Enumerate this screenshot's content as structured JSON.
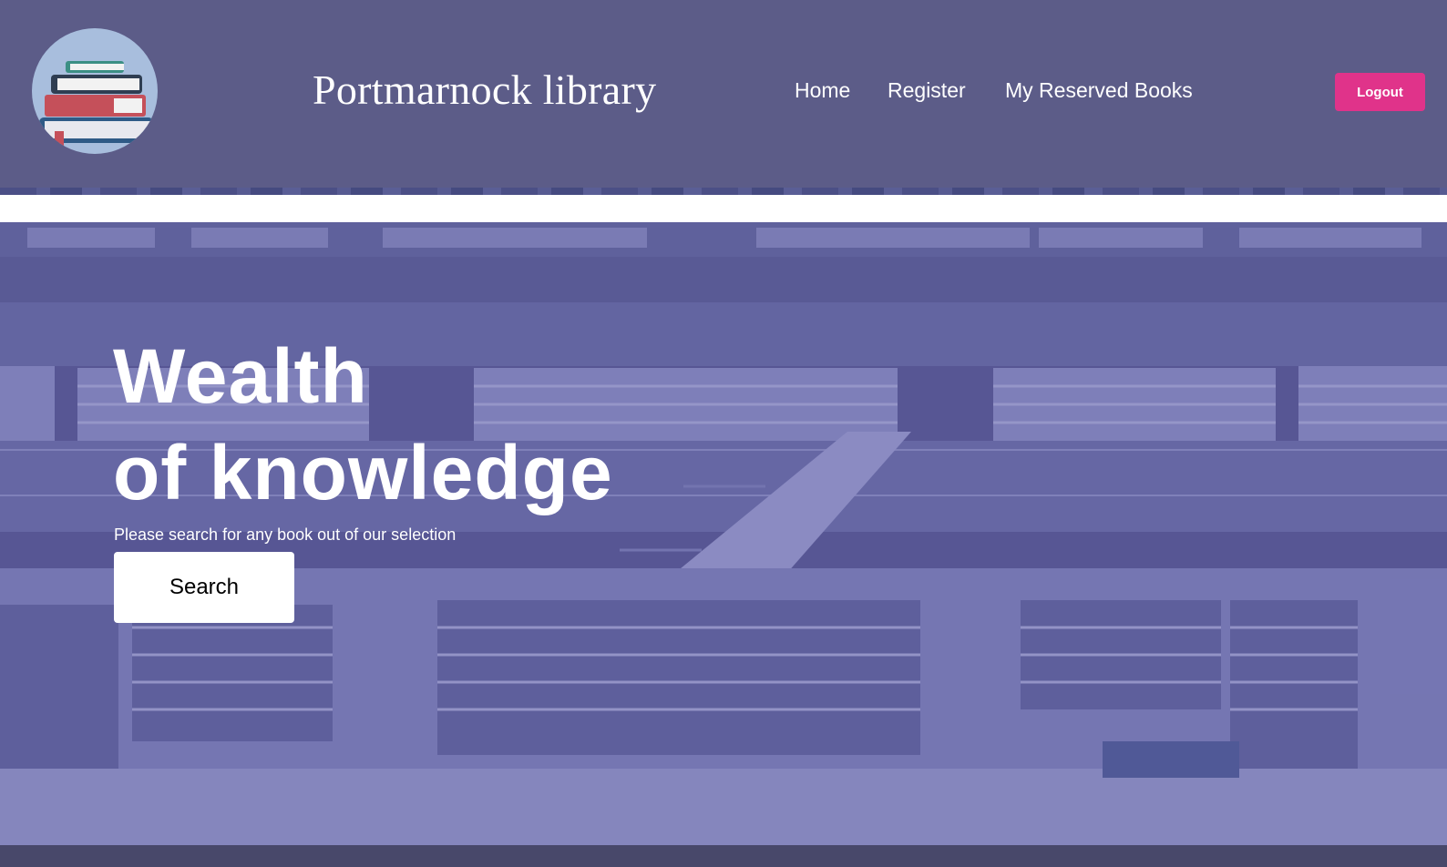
{
  "header": {
    "brand": "Portmarnock library",
    "logo_icon": "books-stack-icon",
    "nav": {
      "home": "Home",
      "register": "Register",
      "reserved": "My Reserved Books"
    },
    "logout_label": "Logout"
  },
  "hero": {
    "headline_line1": "Wealth",
    "headline_line2": "of knowledge",
    "subtext": "Please search for any book out of our selection",
    "search_label": "Search",
    "background_image": "library-interior-photo"
  },
  "colors": {
    "header_bg": "#5c5c88",
    "logout_bg": "#e0338a",
    "hero_tint": "#5b5c96",
    "logo_circle": "#a8bedd"
  }
}
